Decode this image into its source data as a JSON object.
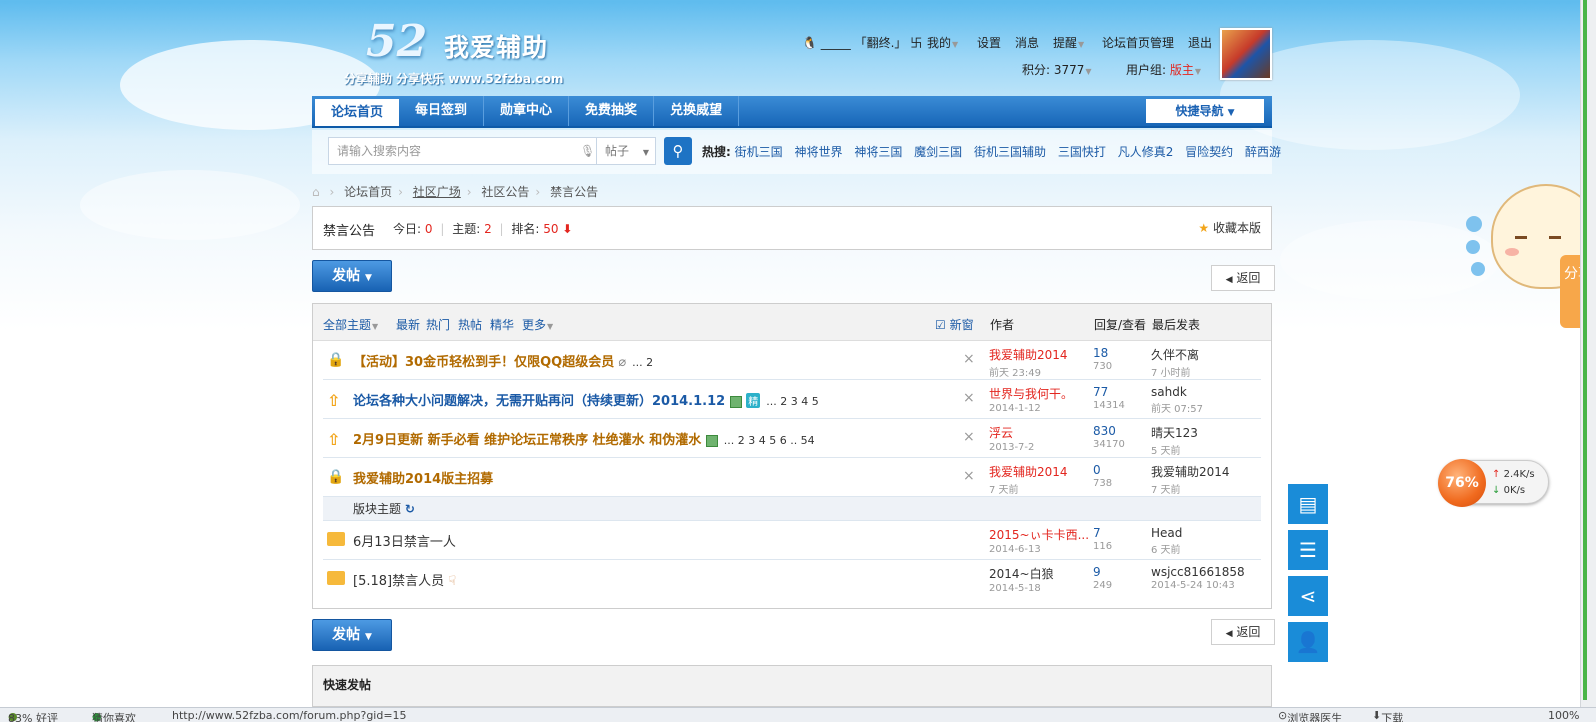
{
  "header": {
    "logo_number": "52",
    "logo_name": "我爱辅助",
    "logo_sub": "分享辅助 分享快乐 www.52fzba.com",
    "username": "_____ 「翻终.」 卐",
    "menu": [
      "我的",
      "设置",
      "消息",
      "提醒",
      "论坛首页管理",
      "退出"
    ],
    "credits_label": "积分: ",
    "credits_value": "3777",
    "usergroup_label": "用户组: ",
    "usergroup_value": "版主"
  },
  "nav": {
    "items": [
      "论坛首页",
      "每日签到",
      "勋章中心",
      "免费抽奖",
      "兑换威望"
    ],
    "quick_nav": "快捷导航"
  },
  "search": {
    "placeholder": "请输入搜索内容",
    "type": "帖子",
    "hot_label": "热搜:",
    "hot_terms": [
      "街机三国",
      "神将世界",
      "神将三国",
      "魔剑三国",
      "街机三国辅助",
      "三国快打",
      "凡人修真2",
      "冒险契约",
      "醉西游"
    ]
  },
  "breadcrumb": [
    "论坛首页",
    "社区广场",
    "社区公告",
    "禁言公告"
  ],
  "forum": {
    "name": "禁言公告",
    "today_label": "今日: ",
    "today": "0",
    "threads_label": "主题: ",
    "threads": "2",
    "rank_label": "排名: ",
    "rank": "50",
    "favorite": "收藏本版"
  },
  "buttons": {
    "new_post": "发帖",
    "back": "返回"
  },
  "table": {
    "filters": [
      "全部主题",
      "最新",
      "热门",
      "热帖",
      "精华",
      "更多"
    ],
    "new_window": "新窗",
    "col_author": "作者",
    "col_reply": "回复/查看",
    "col_last": "最后发表",
    "section_label": "版块主题",
    "sticky": [
      {
        "title": "【活动】30金币轻松到手！仅限QQ超级会员",
        "pages": "... 2",
        "author": "我爱辅助2014",
        "date": "前天 23:49",
        "replies": "18",
        "views": "730",
        "last_user": "久伴不离",
        "last_time": "7 小时前"
      },
      {
        "title": "论坛各种大小问题解决，无需开贴再问（持续更新）2014.1.12",
        "pages": "... 2 3 4 5",
        "author": "世界与我何干。",
        "date": "2014-1-12",
        "replies": "77",
        "views": "14314",
        "last_user": "sahdk",
        "last_time": "前天 07:57"
      },
      {
        "title": "2月9日更新 新手必看 维护论坛正常秩序 杜绝灌水 和伪灌水",
        "pages": "... 2 3 4 5 6 .. 54",
        "author": "浮云",
        "date": "2013-7-2",
        "replies": "830",
        "views": "34170",
        "last_user": "晴天123",
        "last_time": "5 天前"
      },
      {
        "title": "我爱辅助2014版主招募",
        "pages": "",
        "author": "我爱辅助2014",
        "date": "7 天前",
        "replies": "0",
        "views": "738",
        "last_user": "我爱辅助2014",
        "last_time": "7 天前"
      }
    ],
    "normal": [
      {
        "title": "6月13日禁言一人",
        "author": "2015~ぃ卡卡西...",
        "date": "2014-6-13",
        "replies": "7",
        "views": "116",
        "last_user": "Head",
        "last_time": "6 天前"
      },
      {
        "title": "[5.18]禁言人员",
        "author": "2014~白狼",
        "date": "2014-5-18",
        "replies": "9",
        "views": "249",
        "last_user": "wsjcc81661858",
        "last_time": "2014-5-24 10:43"
      }
    ]
  },
  "quick_post": "快速发帖",
  "speed_widget": {
    "percent": "76%",
    "up": "2.4K/s",
    "down": "0K/s"
  },
  "share_tab": "分享",
  "statusbar": {
    "left": "83% 好评",
    "guess": "猜你喜欢",
    "url": "http://www.52fzba.com/forum.php?gid=15",
    "right1": "浏览器医生",
    "right2": "下载",
    "zoom": "100%"
  },
  "icons": [
    "home-icon",
    "search-icon",
    "star-icon",
    "lock-icon",
    "up-arrow-icon",
    "folder-icon",
    "close-icon",
    "refresh-icon",
    "mic-icon",
    "doc-tool-icon",
    "list-tool-icon",
    "share-tool-icon",
    "user-tool-icon"
  ],
  "colors": {
    "nav_blue": "#1766b7",
    "link_blue": "#1b5aa6",
    "highlight_orange": "#b16a00",
    "red": "#e3261f"
  }
}
